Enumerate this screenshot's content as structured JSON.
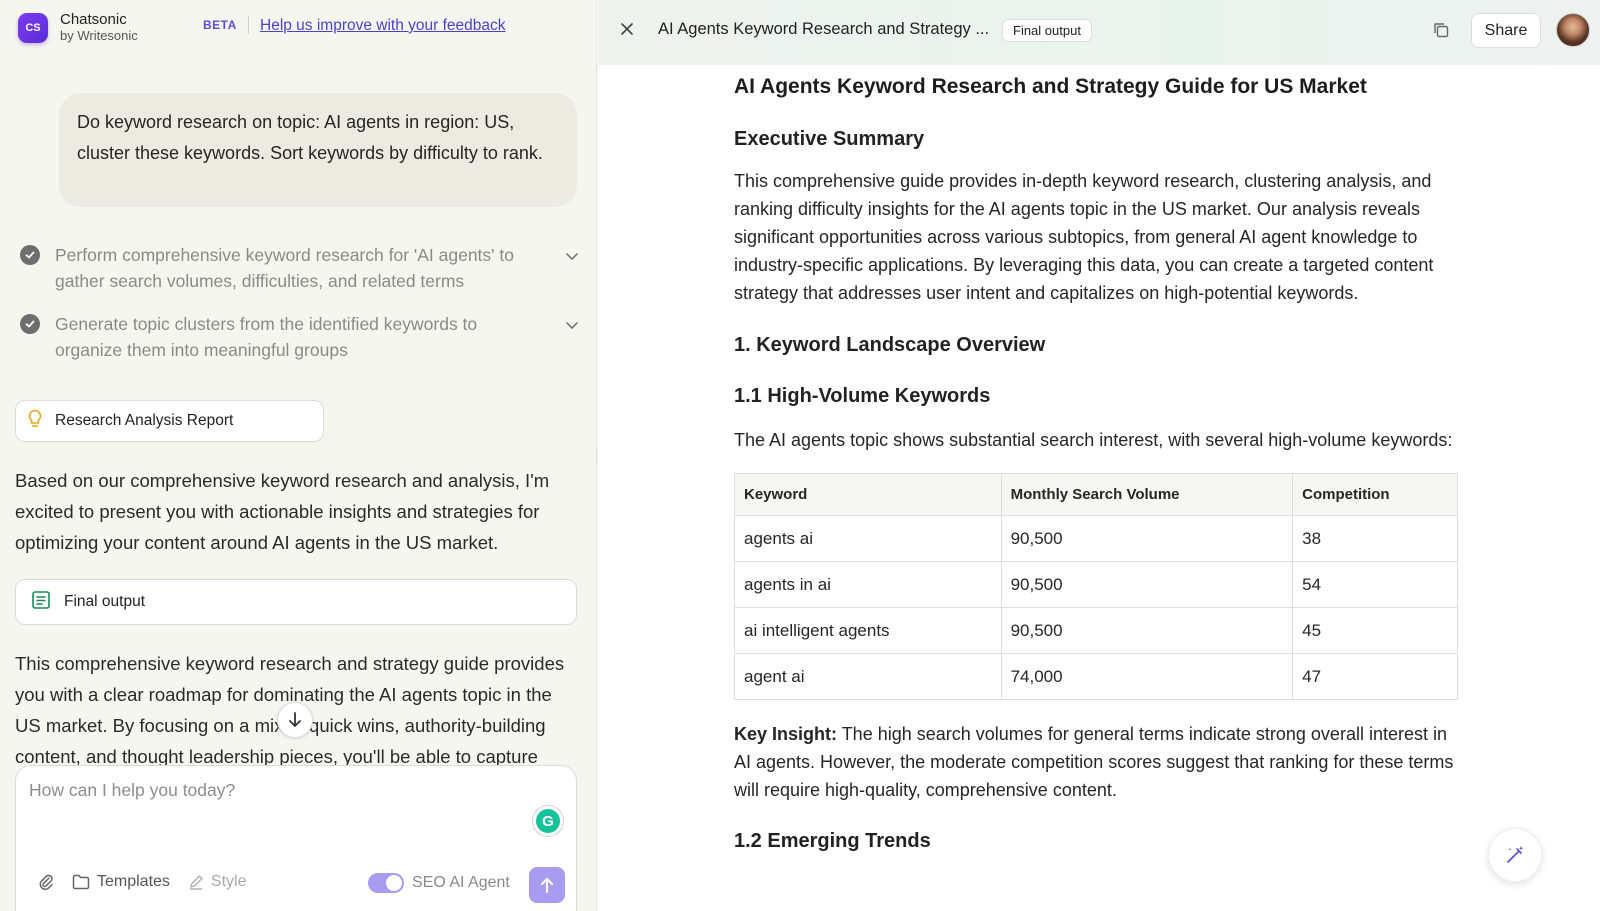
{
  "header": {
    "logo_text": "CS",
    "brand_name": "Chatsonic",
    "brand_sub": "by Writesonic",
    "beta_label": "BETA",
    "feedback_link": "Help us improve with your feedback"
  },
  "chat": {
    "user_message": "Do keyword research on topic: AI agents in region: US, cluster these keywords. Sort keywords by difficulty to rank.",
    "steps": [
      {
        "text": "Perform comprehensive keyword research for 'AI agents' to gather search volumes, difficulties, and related terms",
        "icon": "check-circle-icon"
      },
      {
        "text": "Generate topic clusters from the identified keywords to organize them into meaningful groups",
        "icon": "check-circle-icon"
      }
    ],
    "research_card_label": "Research Analysis Report",
    "reply_paragraph": "Based on our comprehensive keyword research and analysis, I'm excited to present you with actionable insights and strategies for optimizing your content around AI agents in the US market.",
    "final_card_label": "Final output",
    "final_paragraph": "This comprehensive keyword research and strategy guide provides you with a clear roadmap for dominating the AI agents topic in the US market. By focusing on a mix of quick wins, authority-building content, and thought leadership pieces, you'll be able to capture"
  },
  "composer": {
    "placeholder": "How can I help you today?",
    "grammarly_letter": "G",
    "templates_label": "Templates",
    "style_label": "Style",
    "agent_label": "SEO AI Agent",
    "agent_enabled": true
  },
  "panel": {
    "title": "AI Agents Keyword Research and Strategy ...",
    "tag": "Final output",
    "share_label": "Share"
  },
  "document": {
    "title": "AI Agents Keyword Research and Strategy Guide for US Market",
    "exec_heading": "Executive Summary",
    "exec_text": "This comprehensive guide provides in-depth keyword research, clustering analysis, and ranking difficulty insights for the AI agents topic in the US market. Our analysis reveals significant opportunities across various subtopics, from general AI agent knowledge to industry-specific applications. By leveraging this data, you can create a targeted content strategy that addresses user intent and capitalizes on high-potential keywords.",
    "section1_heading": "1. Keyword Landscape Overview",
    "section11_heading": "1.1 High-Volume Keywords",
    "section11_intro": "The AI agents topic shows substantial search interest, with several high-volume keywords:",
    "table": {
      "headers": [
        "Keyword",
        "Monthly Search Volume",
        "Competition"
      ],
      "rows": [
        [
          "agents ai",
          "90,500",
          "38"
        ],
        [
          "agents in ai",
          "90,500",
          "54"
        ],
        [
          "ai intelligent agents",
          "90,500",
          "45"
        ],
        [
          "agent ai",
          "74,000",
          "47"
        ]
      ]
    },
    "insight_label": "Key Insight:",
    "insight_text": " The high search volumes for general terms indicate strong overall interest in AI agents. However, the moderate competition scores suggest that ranking for these terms will require high-quality, comprehensive content.",
    "section12_heading": "1.2 Emerging Trends"
  }
}
